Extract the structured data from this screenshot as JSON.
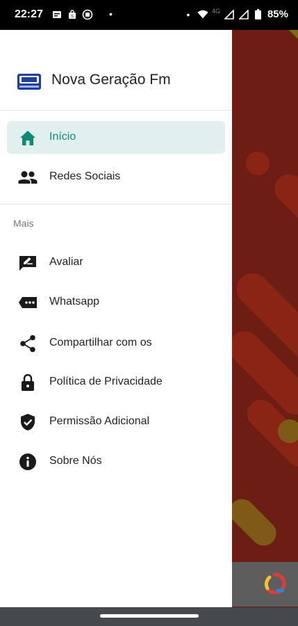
{
  "status_bar": {
    "time": "22:27",
    "dot": "•",
    "network": "4G",
    "battery": "85%"
  },
  "drawer": {
    "app_name": "Nova Geração Fm",
    "items_primary": [
      {
        "label": "Início",
        "icon": "home-icon",
        "active": true
      },
      {
        "label": "Redes Sociais",
        "icon": "people-icon",
        "active": false
      }
    ],
    "section_title": "Mais",
    "items_more": [
      {
        "label": "Avaliar",
        "icon": "rate-review-icon"
      },
      {
        "label": "Whatsapp",
        "icon": "message-icon"
      },
      {
        "label": "Compartilhar com os",
        "icon": "share-icon"
      },
      {
        "label": "Política de Privacidade",
        "icon": "lock-icon"
      },
      {
        "label": "Permissão Adicional",
        "icon": "verified-shield-icon"
      },
      {
        "label": "Sobre Nós",
        "icon": "info-icon"
      }
    ]
  },
  "colors": {
    "active_item_bg": "#e1f0ee",
    "active_item_text": "#0c8a74",
    "background_app": "#6c1d14"
  }
}
